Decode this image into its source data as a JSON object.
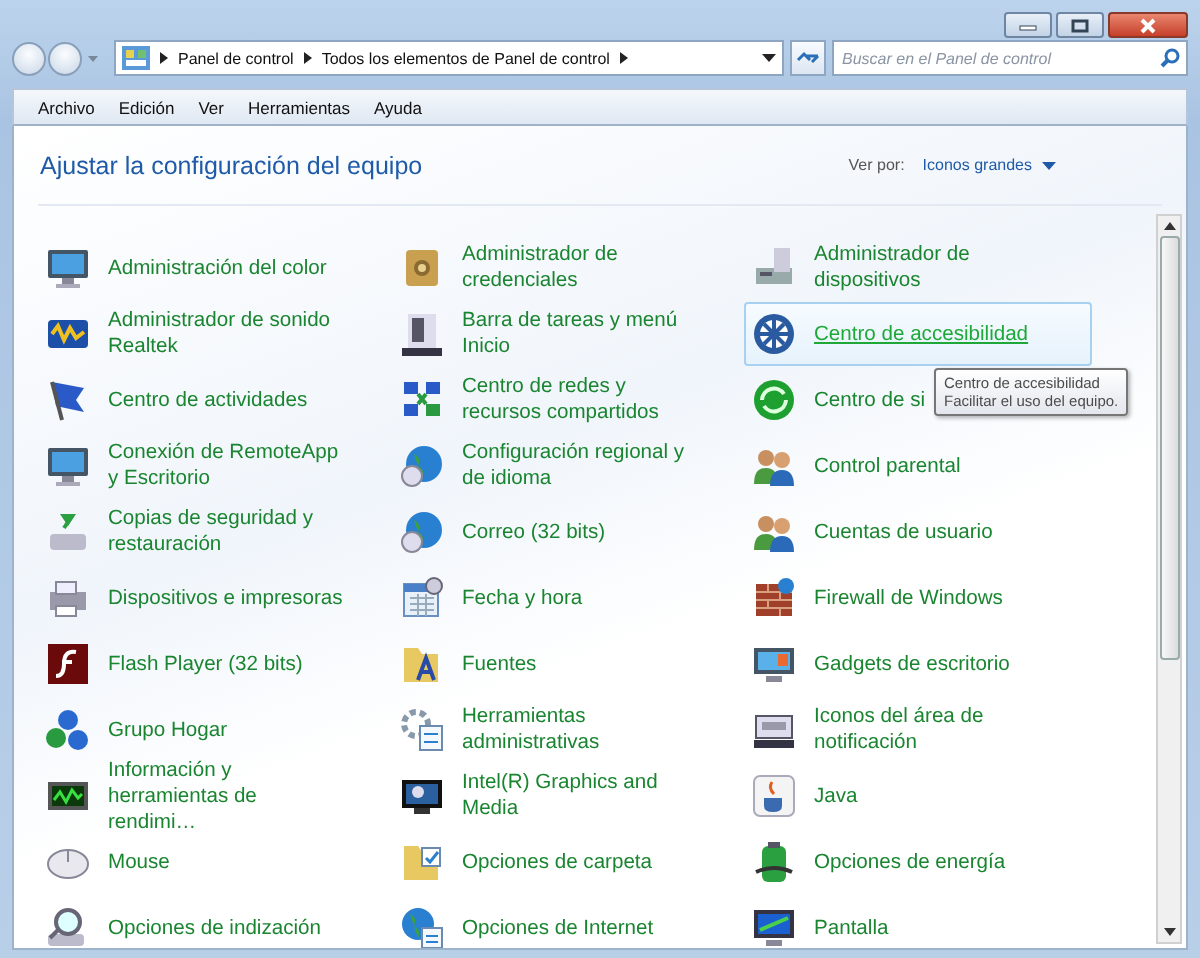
{
  "address_bar": {
    "breadcrumbs": [
      "Panel de control",
      "Todos los elementos de Panel de control"
    ]
  },
  "search": {
    "placeholder": "Buscar en el Panel de control"
  },
  "menu": [
    "Archivo",
    "Edición",
    "Ver",
    "Herramientas",
    "Ayuda"
  ],
  "header": {
    "title": "Ajustar la configuración del equipo",
    "view_by_label": "Ver por:",
    "view_by_value": "Iconos grandes"
  },
  "items": [
    {
      "label": "Administración del color",
      "hovered": false
    },
    {
      "label": "Administrador de credenciales",
      "hovered": false
    },
    {
      "label": "Administrador de dispositivos",
      "hovered": false
    },
    {
      "label": "Administrador de sonido Realtek",
      "hovered": false
    },
    {
      "label": "Barra de tareas y menú Inicio",
      "hovered": false
    },
    {
      "label": "Centro de accesibilidad",
      "hovered": true
    },
    {
      "label": "Centro de actividades",
      "hovered": false
    },
    {
      "label": "Centro de redes y recursos compartidos",
      "hovered": false
    },
    {
      "label": "Centro de si",
      "hovered": false
    },
    {
      "label": "Conexión de RemoteApp y Escritorio",
      "hovered": false
    },
    {
      "label": "Configuración regional y de idioma",
      "hovered": false
    },
    {
      "label": "Control parental",
      "hovered": false
    },
    {
      "label": "Copias de seguridad y restauración",
      "hovered": false
    },
    {
      "label": "Correo (32 bits)",
      "hovered": false
    },
    {
      "label": "Cuentas de usuario",
      "hovered": false
    },
    {
      "label": "Dispositivos e impresoras",
      "hovered": false
    },
    {
      "label": "Fecha y hora",
      "hovered": false
    },
    {
      "label": "Firewall de Windows",
      "hovered": false
    },
    {
      "label": "Flash Player (32 bits)",
      "hovered": false
    },
    {
      "label": "Fuentes",
      "hovered": false
    },
    {
      "label": "Gadgets de escritorio",
      "hovered": false
    },
    {
      "label": "Grupo Hogar",
      "hovered": false
    },
    {
      "label": "Herramientas administrativas",
      "hovered": false
    },
    {
      "label": "Iconos del área de notificación",
      "hovered": false
    },
    {
      "label": "Información y herramientas de rendimi…",
      "hovered": false
    },
    {
      "label": "Intel(R) Graphics and Media",
      "hovered": false
    },
    {
      "label": "Java",
      "hovered": false
    },
    {
      "label": "Mouse",
      "hovered": false
    },
    {
      "label": "Opciones de carpeta",
      "hovered": false
    },
    {
      "label": "Opciones de energía",
      "hovered": false
    },
    {
      "label": "Opciones de indización",
      "hovered": false
    },
    {
      "label": "Opciones de Internet",
      "hovered": false
    },
    {
      "label": "Pantalla",
      "hovered": false
    }
  ],
  "tooltip": {
    "title": "Centro de accesibilidad",
    "text": "Facilitar el uso del equipo."
  }
}
